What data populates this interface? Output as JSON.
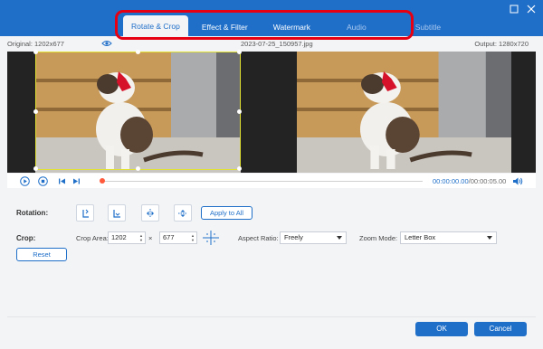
{
  "window": {
    "restore_icon": "restore-icon",
    "close_icon": "close-icon"
  },
  "tabs": [
    {
      "label": "Rotate & Crop",
      "active": true
    },
    {
      "label": "Effect & Filter",
      "active": false
    },
    {
      "label": "Watermark",
      "active": false
    },
    {
      "label": "Audio",
      "active": false
    },
    {
      "label": "Subtitle",
      "active": false
    }
  ],
  "info": {
    "original": "Original: 1202x677",
    "filename": "2023-07-25_150957.jpg",
    "output": "Output: 1280x720"
  },
  "playback": {
    "current_time": "00:00:00.00",
    "total_time": "/00:00:05.00",
    "progress": 0.0
  },
  "rotation": {
    "label": "Rotation:",
    "apply_all": "Apply to All"
  },
  "crop": {
    "label": "Crop:",
    "area_label": "Crop Area:",
    "width": "1202",
    "times": "×",
    "height": "677",
    "aspect_label": "Aspect Ratio:",
    "aspect_value": "Freely",
    "zoom_label": "Zoom Mode:",
    "zoom_value": "Letter Box",
    "reset": "Reset"
  },
  "footer": {
    "ok": "OK",
    "cancel": "Cancel"
  },
  "colors": {
    "accent": "#1f6fc9",
    "highlight": "#e60012",
    "crop_frame": "#e2e232"
  }
}
